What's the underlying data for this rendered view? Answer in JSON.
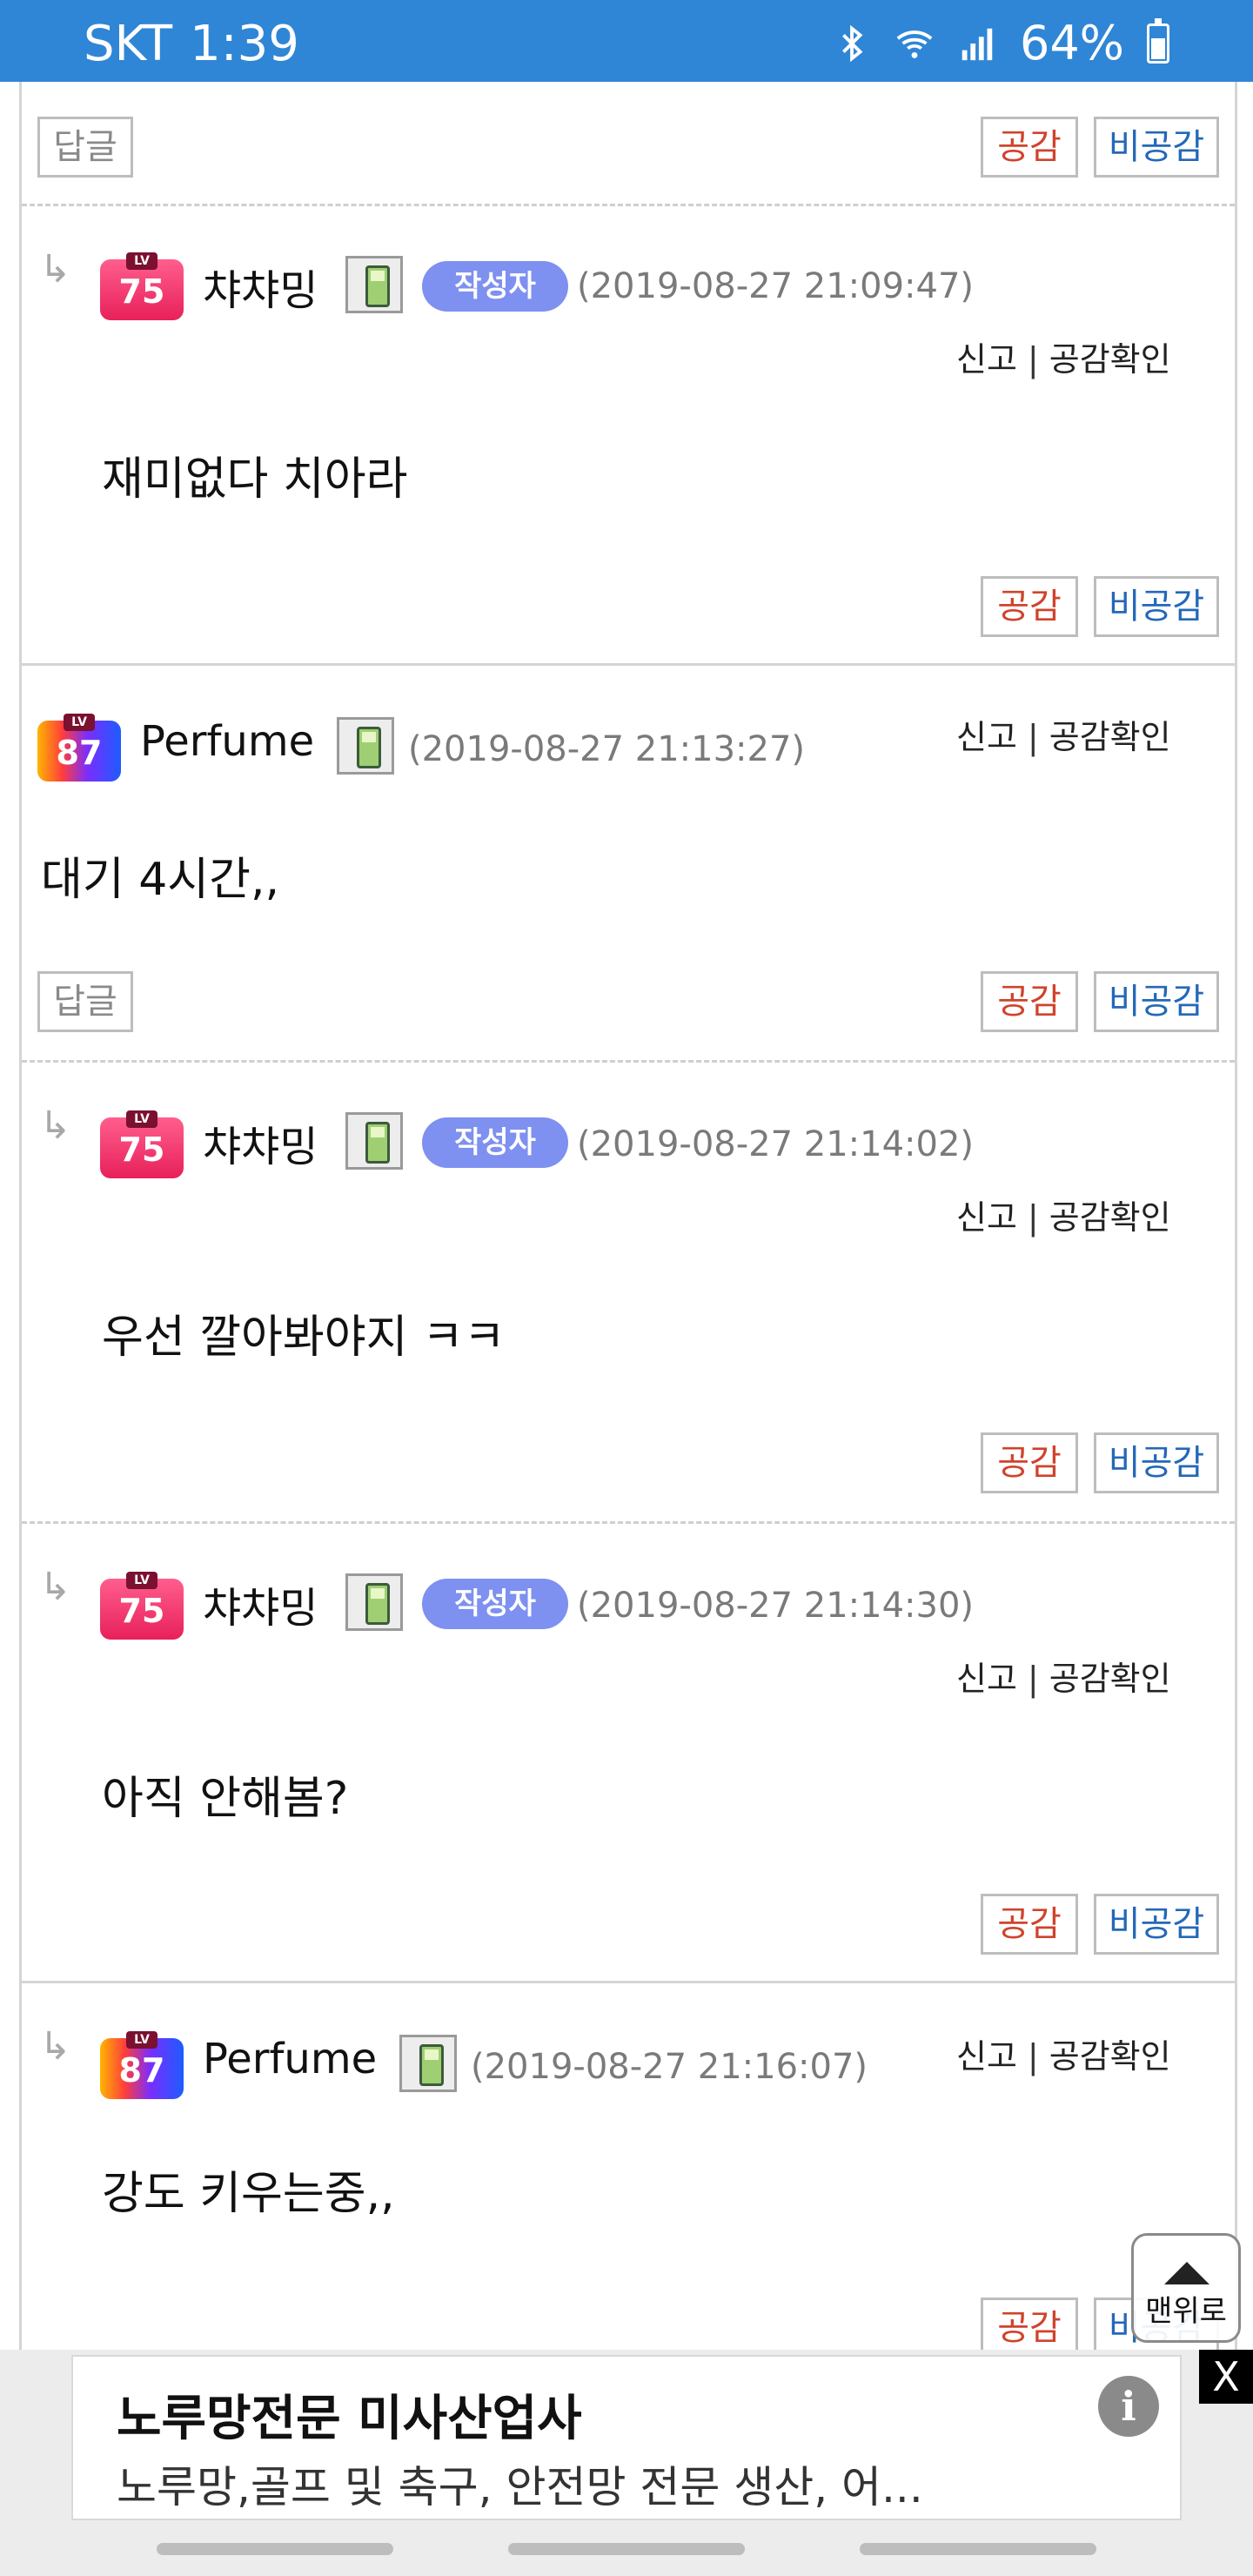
{
  "status_bar": {
    "carrier": "SKT",
    "time": "1:39",
    "battery": "64%"
  },
  "buttons": {
    "reply": "답글",
    "like": "공감",
    "dislike": "비공감"
  },
  "actions": {
    "report": "신고",
    "separator": "|",
    "check_likes": "공감확인"
  },
  "author_badge": "작성자",
  "comments": [
    {
      "level": "75",
      "nick": "챠챠밍",
      "author": true,
      "date": "(2019-08-27 21:09:47)",
      "text": "재미없다 치아라",
      "is_reply": true
    },
    {
      "level": "87",
      "nick": "Perfume",
      "author": false,
      "date": "(2019-08-27 21:13:27)",
      "text": "대기 4시간,,",
      "is_reply": false
    },
    {
      "level": "75",
      "nick": "챠챠밍",
      "author": true,
      "date": "(2019-08-27 21:14:02)",
      "text": "우선 깔아봐야지 ㅋㅋ",
      "is_reply": true
    },
    {
      "level": "75",
      "nick": "챠챠밍",
      "author": true,
      "date": "(2019-08-27 21:14:30)",
      "text": "아직 안해봄?",
      "is_reply": true
    },
    {
      "level": "87",
      "nick": "Perfume",
      "author": false,
      "date": "(2019-08-27 21:16:07)",
      "text": "강도 키우는중,,",
      "is_reply": true
    }
  ],
  "reply_arrow": "↳",
  "scroll_top_label": "맨위로",
  "ad": {
    "title": "노루망전문 미사산업사",
    "description": "노루망,골프 및 축구, 안전망 전문 생산, 어...",
    "info_icon": "i",
    "close_label": "X"
  }
}
